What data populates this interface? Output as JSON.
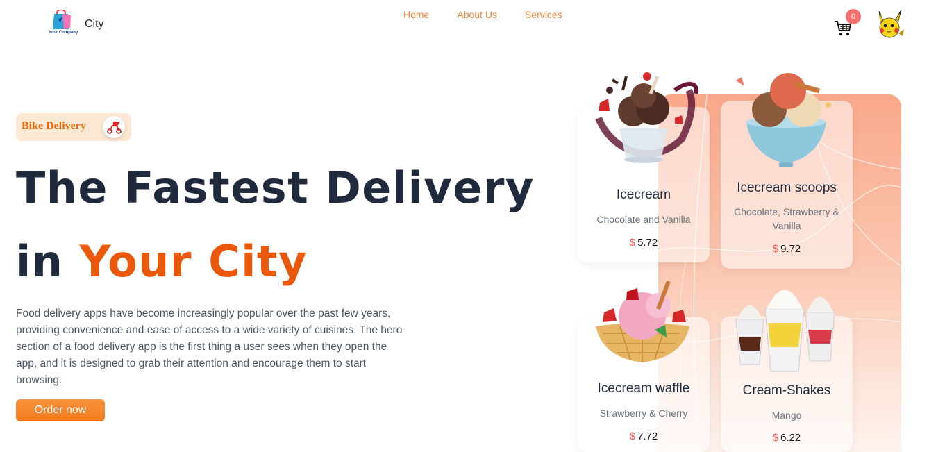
{
  "header": {
    "logo_text": "Your Company",
    "city": "City",
    "nav": [
      "Home",
      "About Us",
      "Services"
    ],
    "cart_count": "0"
  },
  "hero": {
    "badge": "Bike Delivery",
    "headline_line1": "The Fastest Delivery",
    "headline_line2_prefix": "in",
    "headline_line2_accent": "Your City",
    "description": "Food delivery apps have become increasingly popular over the past few years, providing convenience and ease of access to a wide variety of cuisines. The hero section of a food delivery app is the first thing a user sees when they open the app, and it is designed to grab their attention and encourage them to start browsing.",
    "cta": "Order now"
  },
  "products": [
    {
      "name": "Icecream",
      "desc": "Chocolate and Vanilla",
      "currency": "$",
      "price": "5.72",
      "icon": "chocolate-icecream-icon"
    },
    {
      "name": "Icecream scoops",
      "desc": "Chocolate, Strawberry & Vanilla",
      "currency": "$",
      "price": "9.72",
      "icon": "icecream-bowl-icon"
    },
    {
      "name": "Icecream waffle",
      "desc": "Strawberry & Cherry",
      "currency": "$",
      "price": "7.72",
      "icon": "waffle-bowl-icon"
    },
    {
      "name": "Cream-Shakes",
      "desc": "Mango",
      "currency": "$",
      "price": "6.22",
      "icon": "milkshake-cups-icon"
    }
  ],
  "colors": {
    "accent": "#ea580c",
    "nav": "#f0883e",
    "heading": "#1f2a3c",
    "price_currency": "#ef4444"
  }
}
